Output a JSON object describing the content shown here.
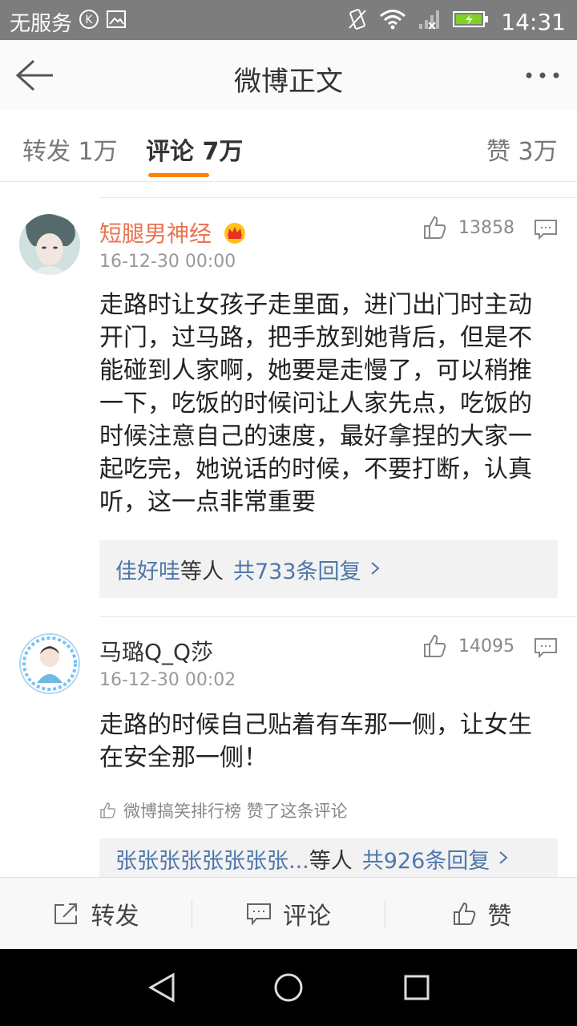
{
  "status_bar": {
    "carrier": "无服务",
    "time": "14:31"
  },
  "header": {
    "title": "微博正文"
  },
  "tabs": [
    {
      "label": "转发 1万"
    },
    {
      "label": "评论 7万"
    },
    {
      "label": "赞 3万"
    }
  ],
  "comments": [
    {
      "username": "短腿男神经",
      "time": "16-12-30 00:00",
      "likes": "13858",
      "text": "走路时让女孩子走里面，进门出门时主动开门，过马路，把手放到她背后，但是不能碰到人家啊，她要是走慢了，可以稍推一下，吃饭的时候问让人家先点，吃饭的时候注意自己的速度，最好拿捏的大家一起吃完，她说话的时候，不要打断，认真听，这一点非常重要",
      "reply_names": "佳好哇",
      "reply_mid": "等人",
      "reply_count": "共733条回复",
      "username_color": "#eb7350"
    },
    {
      "username": "马璐Q_Q莎",
      "time": "16-12-30 00:02",
      "likes": "14095",
      "text": "走路的时候自己贴着有车那一侧，让女生在安全那一侧！",
      "liked_by": "微博搞笑排行榜 赞了这条评论",
      "reply_names": "张张张张张张张张...",
      "reply_mid": "等人",
      "reply_count": "共926条回复",
      "username_color": "#333333"
    }
  ],
  "bottom_bar": {
    "repost": "转发",
    "comment": "评论",
    "like": "赞"
  },
  "colors": {
    "accent": "#ff8200",
    "link": "#4e77aa"
  }
}
